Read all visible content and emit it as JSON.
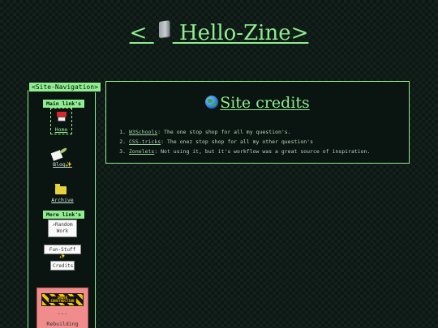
{
  "header": {
    "bracket_left": "<",
    "title": "Hello-Zine",
    "bracket_right": ">",
    "icon": "phone-icon"
  },
  "sidebar": {
    "label": "<Site-Navigation>",
    "main_links_label": "Main link's",
    "home": "Home",
    "blog": "Blog",
    "blog_emoji": "✨",
    "archive": "Archive",
    "more_links_label": "More link's",
    "random_work": "Random Work",
    "fun_stuff": "Fun-Stuff",
    "fun_emoji": "✨",
    "credits": "Credits",
    "construction_badge": "UNDER CONSTRUCTION",
    "construction_dash": "---",
    "construction_status": "Rebuilding"
  },
  "main": {
    "heading": "Site credits",
    "credits": [
      {
        "link": "W3Schools",
        "text": ": The one stop shop for all my question's."
      },
      {
        "link": "CSS-tricks",
        "text": ": The onez stop shop for all my other question's"
      },
      {
        "link": "Zonelets",
        "text": ": Not using it, but it's workflow was a great source of inspiration."
      }
    ]
  },
  "colors": {
    "accent": "#90ee90",
    "panel_bg": "#0a1410",
    "construction_bg": "#f08c8c"
  }
}
